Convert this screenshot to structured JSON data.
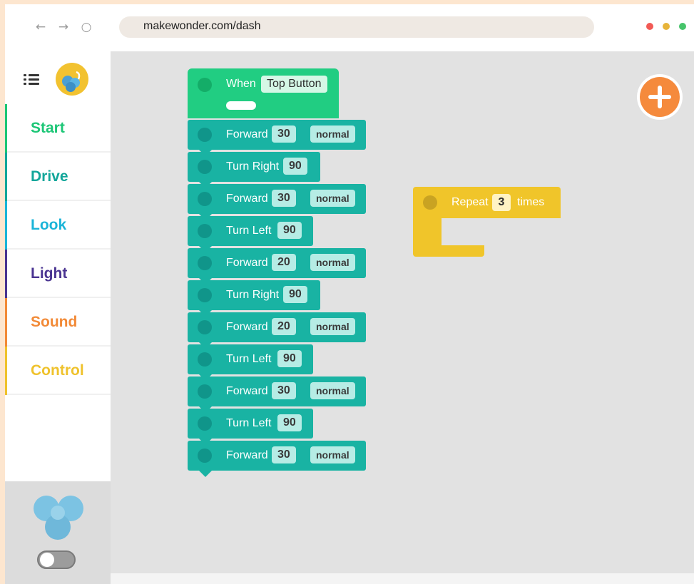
{
  "browser": {
    "url": "makewonder.com/dash",
    "nav": {
      "back": "←",
      "forward": "→",
      "reload": "○"
    },
    "dots": [
      "#f25a55",
      "#e7b43a",
      "#46c46a"
    ]
  },
  "sidebar": {
    "categories": [
      {
        "label": "Start",
        "color": "#1cc676"
      },
      {
        "label": "Drive",
        "color": "#12a69a"
      },
      {
        "label": "Look",
        "color": "#1ab4d8"
      },
      {
        "label": "Light",
        "color": "#4a3491"
      },
      {
        "label": "Sound",
        "color": "#f28a37"
      },
      {
        "label": "Control",
        "color": "#efc22c"
      }
    ]
  },
  "workspace": {
    "when_block": {
      "label": "When",
      "trigger": "Top Button"
    },
    "blocks": [
      {
        "label": "Forward",
        "value": "30",
        "speed": "normal"
      },
      {
        "label": "Turn Right",
        "value": "90"
      },
      {
        "label": "Forward",
        "value": "30",
        "speed": "normal"
      },
      {
        "label": "Turn Left",
        "value": "90"
      },
      {
        "label": "Forward",
        "value": "20",
        "speed": "normal"
      },
      {
        "label": "Turn Right",
        "value": "90"
      },
      {
        "label": "Forward",
        "value": "20",
        "speed": "normal"
      },
      {
        "label": "Turn Left",
        "value": "90"
      },
      {
        "label": "Forward",
        "value": "30",
        "speed": "normal"
      },
      {
        "label": "Turn Left",
        "value": "90"
      },
      {
        "label": "Forward",
        "value": "30",
        "speed": "normal"
      }
    ],
    "repeat_block": {
      "label": "Repeat",
      "count": "3",
      "suffix": "times"
    }
  },
  "colors": {
    "drive_block": "#19b3a3",
    "start_block": "#21cd82",
    "control_block": "#f0c52a",
    "add_button": "#f58a3c"
  }
}
